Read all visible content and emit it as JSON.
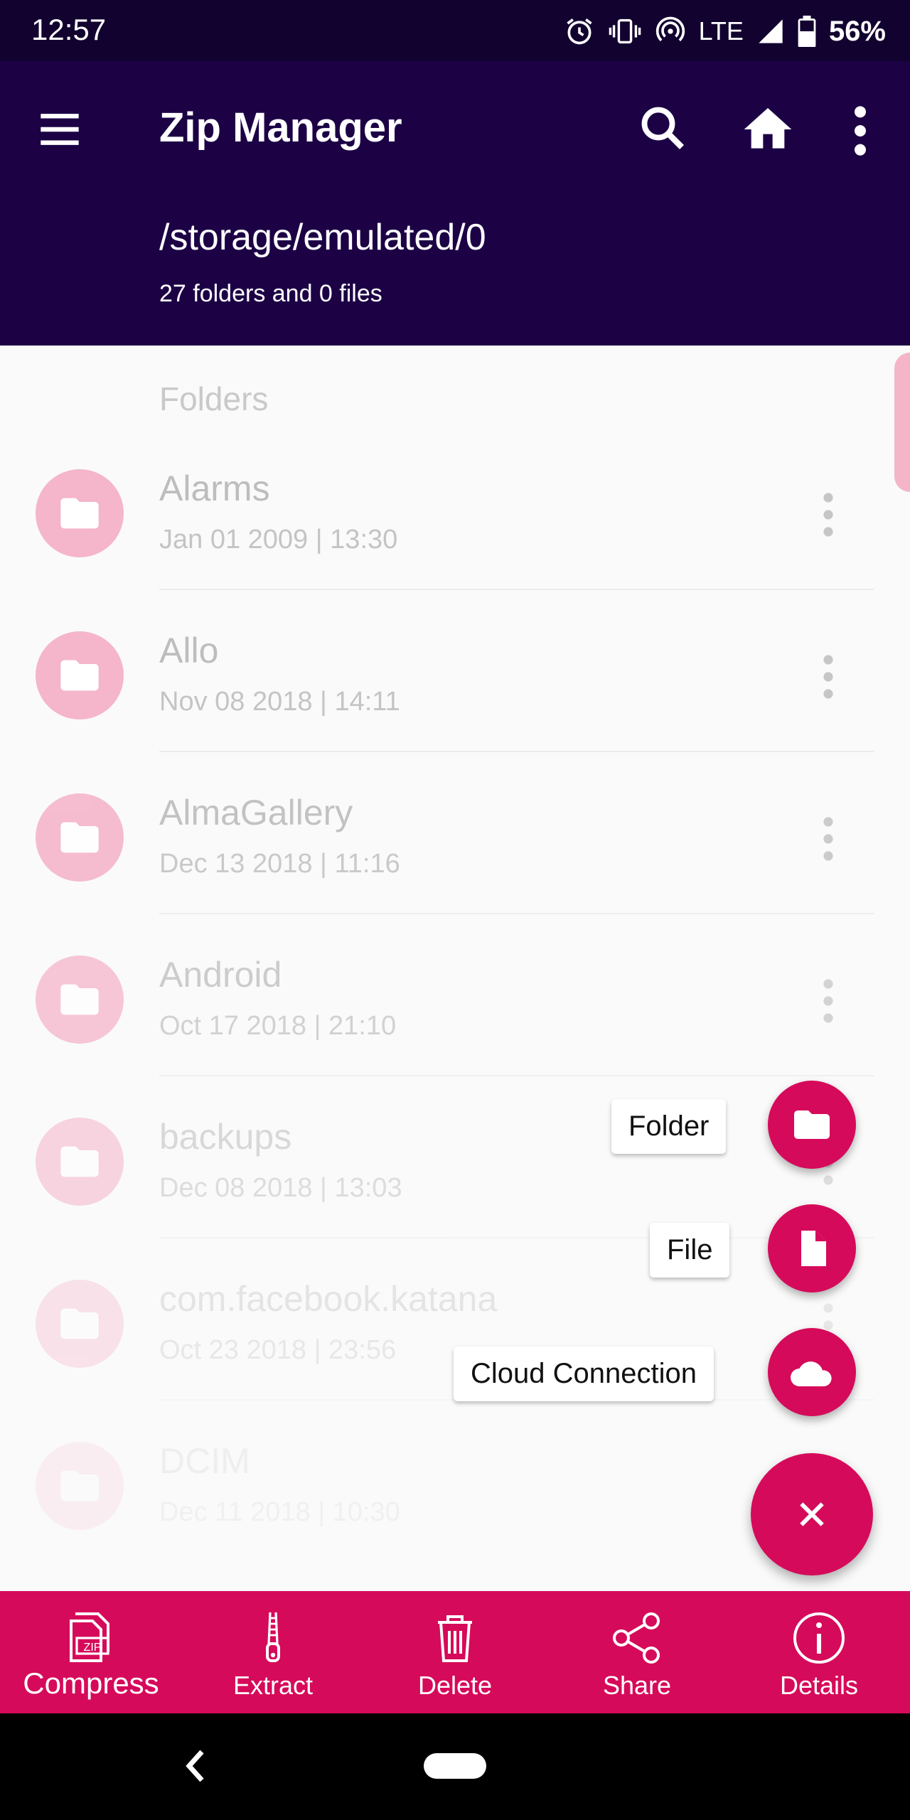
{
  "status_bar": {
    "time": "12:57",
    "network": "LTE",
    "battery": "56%"
  },
  "app_bar": {
    "title": "Zip Manager",
    "path": "/storage/emulated/0",
    "summary": "27 folders and 0 files"
  },
  "list": {
    "section_header": "Folders",
    "items": [
      {
        "name": "Alarms",
        "date": "Jan 01 2009 | 13:30"
      },
      {
        "name": "Allo",
        "date": "Nov 08 2018 | 14:11"
      },
      {
        "name": "AlmaGallery",
        "date": "Dec 13 2018 | 11:16"
      },
      {
        "name": "Android",
        "date": "Oct 17 2018 | 21:10"
      },
      {
        "name": "backups",
        "date": "Dec 08 2018 | 13:03"
      },
      {
        "name": "com.facebook.katana",
        "date": "Oct 23 2018 | 23:56"
      },
      {
        "name": "DCIM",
        "date": "Dec 11 2018 | 10:30"
      }
    ]
  },
  "fab_menu": {
    "folder_label": "Folder",
    "file_label": "File",
    "cloud_label": "Cloud Connection"
  },
  "bottom_bar": {
    "compress": "Compress",
    "extract": "Extract",
    "delete": "Delete",
    "share": "Share",
    "details": "Details"
  },
  "colors": {
    "status_bar": "#12022f",
    "app_bar": "#1c0245",
    "accent": "#d60a5a",
    "folder_circle": "#f5b5ca"
  }
}
